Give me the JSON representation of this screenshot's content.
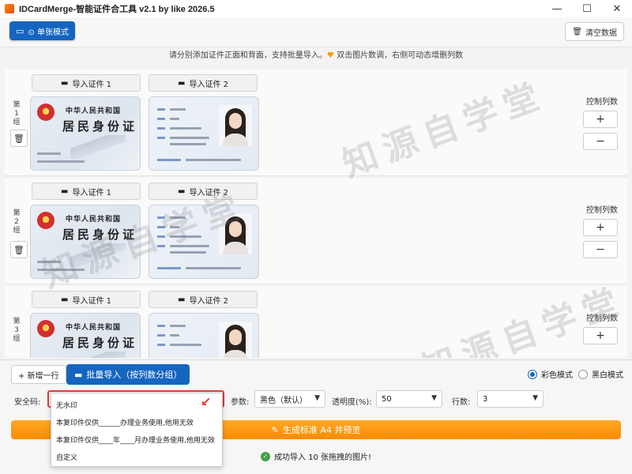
{
  "window": {
    "title": "IDCardMerge-智能证件合工具 v2.1 by like 2026.5",
    "minimize": "—",
    "maximize": "☐",
    "close": "✕"
  },
  "toolbar": {
    "single_mode_label": "⊙ 单张模式",
    "clear_label": "清空数据"
  },
  "hint": {
    "text_before": "请分别添加证件正面和背面，支持批量导入。",
    "star": "♥",
    "text_after": " 双击图片数调，右侧可动态增删列数"
  },
  "groups": [
    {
      "label": "第1组",
      "import1": "导入证件 1",
      "import2": "导入证件 2",
      "card_nation": "中华人民共和国",
      "card_title": "居民身份证",
      "ctl_label": "控制列数",
      "plus": "+",
      "minus": "−"
    },
    {
      "label": "第2组",
      "import1": "导入证件 1",
      "import2": "导入证件 2",
      "card_nation": "中华人民共和国",
      "card_title": "居民身份证",
      "ctl_label": "控制列数",
      "plus": "+",
      "minus": "−"
    },
    {
      "label": "第3组",
      "import1": "导入证件 1",
      "import2": "导入证件 2",
      "card_nation": "中华人民共和国",
      "card_title": "居民身份证",
      "ctl_label": "控制列数",
      "plus": "+",
      "minus": "−"
    }
  ],
  "watermark": "知源自学堂",
  "bottom": {
    "add_row": "+ 新增一行",
    "batch_import": "批量导入（按列数分组）",
    "mode_color": "彩色模式",
    "mode_bw": "黑白模式",
    "security_label": "安全码:",
    "security_value": "",
    "param_label": "参数:",
    "param_value": "黑色（默认）",
    "transparency_label": "透明度(%):",
    "transparency_value": "50",
    "rows_label": "行数:",
    "rows_value": "3",
    "generate_label": "生成标准 A4 并预览",
    "status": "成功导入 10 张拖拽的图片!"
  },
  "dropdown": [
    "无水印",
    "本复印件仅供______办理业务使用,他用无效",
    "本复印件仅供____年____月办理业务使用,他用无效",
    "自定义"
  ],
  "colors": {
    "primary": "#1565c0",
    "accent": "#fb8c00",
    "highlight": "#e53935"
  }
}
